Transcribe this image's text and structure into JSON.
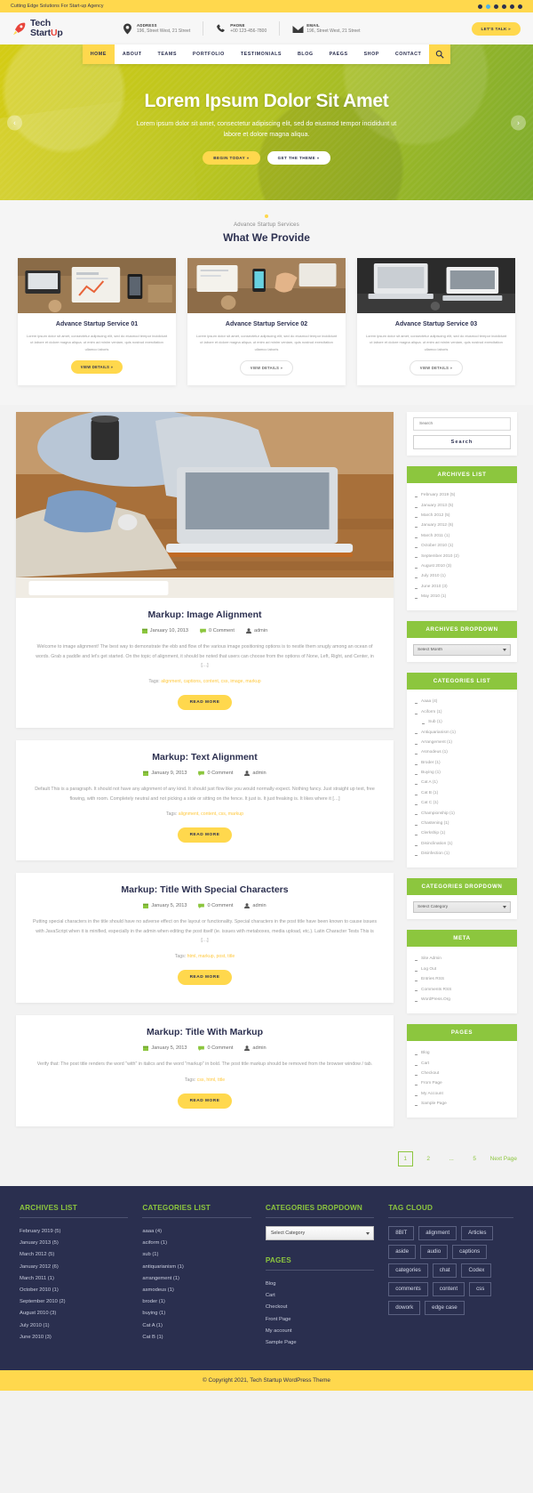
{
  "topbar": {
    "tagline": "Cutting Edge Solutions For Start-up Agency",
    "social": [
      "facebook-icon",
      "twitter-icon",
      "linkedin-icon",
      "youtube-icon",
      "pinterest-icon",
      "instagram-icon"
    ]
  },
  "header": {
    "logo_line1": "Tech",
    "logo_line2_a": "Start",
    "logo_line2_u": "U",
    "logo_line2_b": "p",
    "info": [
      {
        "label": "ADDRESS",
        "value": "196, Street West, 21 Street",
        "icon": "location-pin-icon"
      },
      {
        "label": "PHONE",
        "value": "+00 123-456-7800",
        "icon": "phone-icon"
      },
      {
        "label": "EMAIL",
        "value": "196, Street West, 21 Street",
        "icon": "envelope-icon"
      }
    ],
    "cta_label": "LET'S TALK »"
  },
  "nav": {
    "items": [
      {
        "label": "HOME",
        "active": true
      },
      {
        "label": "ABOUT",
        "active": false
      },
      {
        "label": "TEAMS",
        "active": false
      },
      {
        "label": "PORTFOLIO",
        "active": false
      },
      {
        "label": "TESTIMONIALS",
        "active": false
      },
      {
        "label": "BLOG",
        "active": false
      },
      {
        "label": "PAEGS",
        "active": false
      },
      {
        "label": "SHOP",
        "active": false
      },
      {
        "label": "CONTACT",
        "active": false
      }
    ],
    "search_icon": "search-icon"
  },
  "hero": {
    "title": "Lorem Ipsum Dolor Sit Amet",
    "subtitle": "Lorem ipsum dolor sit amet, consectetur adipiscing elit, sed do eiusmod tempor incididunt ut labore et dolore magna aliqua.",
    "btn_primary": "BEGIN TODAY »",
    "btn_secondary": "GET THE THEME »",
    "prev_icon": "chevron-left-icon",
    "next_icon": "chevron-right-icon"
  },
  "services": {
    "eyebrow": "Advance Startup Services",
    "title": "What We Provide",
    "cards": [
      {
        "title": "Advance Startup Service 01",
        "text": "Lorem ipsum dolor sit amet, consectetur adipiscing elit, sed do eiusmod tempor incididunt ut labore et dolore magna aliqua. ut enim ad minim veniam, quis nostrud exercitation ullamco laboris",
        "button": "VIEW DETAILS »",
        "primary": true
      },
      {
        "title": "Advance Startup Service 02",
        "text": "Lorem ipsum dolor sit amet, consectetur adipiscing elit, sed do eiusmod tempor incididunt ut labore et dolore magna aliqua. ut enim ad minim veniam, quis nostrud exercitation ullamco laboris",
        "button": "VIEW DETAILS »",
        "primary": false
      },
      {
        "title": "Advance Startup Service 03",
        "text": "Lorem ipsum dolor sit amet, consectetur adipiscing elit, sed do eiusmod tempor incididunt ut labore et dolore magna aliqua. ut enim ad minim veniam, quis nostrud exercitation ullamco laboris",
        "button": "VIEW DETAILS »",
        "primary": false
      }
    ]
  },
  "posts": [
    {
      "title": "Markup: Image Alignment",
      "date": "January 10, 2013",
      "comments": "0 Comment",
      "author": "admin",
      "excerpt": "Welcome to image alignment! The best way to demonstrate the ebb and flow of the various image positioning options is to nestle them snugly among an ocean of words. Grab a paddle and let's get started. On the topic of alignment, it should be noted that users can choose from the options of None, Left, Right, and Center, in […]",
      "tags_label": "Tags:",
      "tags": "alignment, captions, content, css, image, markup",
      "button": "READ MORE",
      "has_image": true
    },
    {
      "title": "Markup: Text Alignment",
      "date": "January 9, 2013",
      "comments": "0 Comment",
      "author": "admin",
      "excerpt": "Default This is a paragraph. It should not have any alignment of any kind. It should just flow like you would normally expect. Nothing fancy. Just straight up text, free flowing, with room. Completely neutral and not picking a side or sitting on the fence. It just is. It just freaking is. It likes where it […]",
      "tags_label": "Tags:",
      "tags": "alignment, content, css, markup",
      "button": "READ MORE",
      "has_image": false
    },
    {
      "title": "Markup: Title With Special Characters",
      "date": "January 5, 2013",
      "comments": "0 Comment",
      "author": "admin",
      "excerpt": "Putting special characters in the title should have no adverse effect on the layout or functionality. Special characters in the post title have been known to cause issues with JavaScript when it is minified, especially in the admin when editing the post itself (ie. issues with metaboxes, media upload, etc.). Latin Character Tests This is […]",
      "tags_label": "Tags:",
      "tags": "html, markup, post, title",
      "button": "READ MORE",
      "has_image": false
    },
    {
      "title": "Markup: Title With Markup",
      "date": "January 5, 2013",
      "comments": "0 Comment",
      "author": "admin",
      "excerpt": "Verify that: The post title renders the word \"with\" in italics and the word \"markup\" in bold. The post title markup should be removed from the browser window / tab.",
      "tags_label": "Tags:",
      "tags": "css, html, title",
      "button": "READ MORE",
      "has_image": false
    }
  ],
  "pagination": {
    "pages": [
      "1",
      "2",
      "...",
      "5"
    ],
    "active": "1",
    "next_label": "Next Page"
  },
  "sidebar": {
    "search": {
      "placeholder": "Search",
      "button": "Search"
    },
    "archives_list": {
      "title": "ARCHIVES LIST",
      "items": [
        "February 2019 (5)",
        "January 2013 (5)",
        "March 2012 (5)",
        "January 2012 (6)",
        "March 2011 (1)",
        "October 2010 (1)",
        "September 2010 (2)",
        "August 2010 (3)",
        "July 2010 (1)",
        "June 2010 (3)",
        "May 2010 (1)"
      ]
    },
    "archives_dropdown": {
      "title": "ARCHIVES DROPDOWN",
      "selected": "Select Month"
    },
    "categories_list": {
      "title": "CATEGORIES LIST",
      "items": [
        {
          "label": "Aaaa (4)",
          "sub": false
        },
        {
          "label": "Aciform (1)",
          "sub": false
        },
        {
          "label": "Sub (1)",
          "sub": true
        },
        {
          "label": "Antiquarianism (1)",
          "sub": false
        },
        {
          "label": "Arrangement (1)",
          "sub": false
        },
        {
          "label": "Asmodeus (1)",
          "sub": false
        },
        {
          "label": "Broder (1)",
          "sub": false
        },
        {
          "label": "Buying (1)",
          "sub": false
        },
        {
          "label": "Cat A (1)",
          "sub": false
        },
        {
          "label": "Cat B (1)",
          "sub": false
        },
        {
          "label": "Cat C (1)",
          "sub": false
        },
        {
          "label": "Championship (1)",
          "sub": false
        },
        {
          "label": "Chastening (1)",
          "sub": false
        },
        {
          "label": "Clerkship (1)",
          "sub": false
        },
        {
          "label": "Disinclination (1)",
          "sub": false
        },
        {
          "label": "Disinfection (1)",
          "sub": false
        }
      ]
    },
    "categories_dropdown": {
      "title": "CATEGORIES DROPDOWN",
      "selected": "Select Category"
    },
    "meta": {
      "title": "META",
      "items": [
        "Site Admin",
        "Log Out",
        "Entries RSS",
        "Comments RSS",
        "WordPress.Org"
      ]
    },
    "pages": {
      "title": "PAGES",
      "items": [
        "Blog",
        "Cart",
        "Checkout",
        "From Page",
        "My Account",
        "Sample Page"
      ]
    }
  },
  "footer": {
    "archives": {
      "title": "ARCHIVES LIST",
      "items": [
        "February 2019 (5)",
        "January 2013 (5)",
        "March 2012 (5)",
        "January 2012 (6)",
        "March 2011 (1)",
        "October 2010 (1)",
        "September 2010 (2)",
        "August 2010 (3)",
        "July 2010 (1)",
        "June 2010 (3)"
      ]
    },
    "categories": {
      "title": "CATEGORIES LIST",
      "items": [
        "aaaa (4)",
        "aciform (1)",
        "sub (1)",
        "antiquarianism (1)",
        "arrangement (1)",
        "asmodeus (1)",
        "broder (1)",
        "buying (1)",
        "Cat A (1)",
        "Cat B (1)"
      ]
    },
    "categories_dropdown": {
      "title": "CATEGORIES DROPDOWN",
      "selected": "Select Category"
    },
    "pages": {
      "title": "PAGES",
      "items": [
        "Blog",
        "Cart",
        "Checkout",
        "Front Page",
        "My account",
        "Sample Page"
      ]
    },
    "tagcloud": {
      "title": "TAG CLOUD",
      "tags": [
        "8BIT",
        "alignment",
        "Articles",
        "aside",
        "audio",
        "captions",
        "categories",
        "chat",
        "Codex",
        "comments",
        "content",
        "css",
        "dowork",
        "edge case"
      ]
    },
    "copyright": "© Copyright 2021, Tech Startup WordPress Theme"
  },
  "colors": {
    "accent_yellow": "#ffd84d",
    "accent_green": "#8cc63e",
    "navy": "#2a2f4f"
  }
}
